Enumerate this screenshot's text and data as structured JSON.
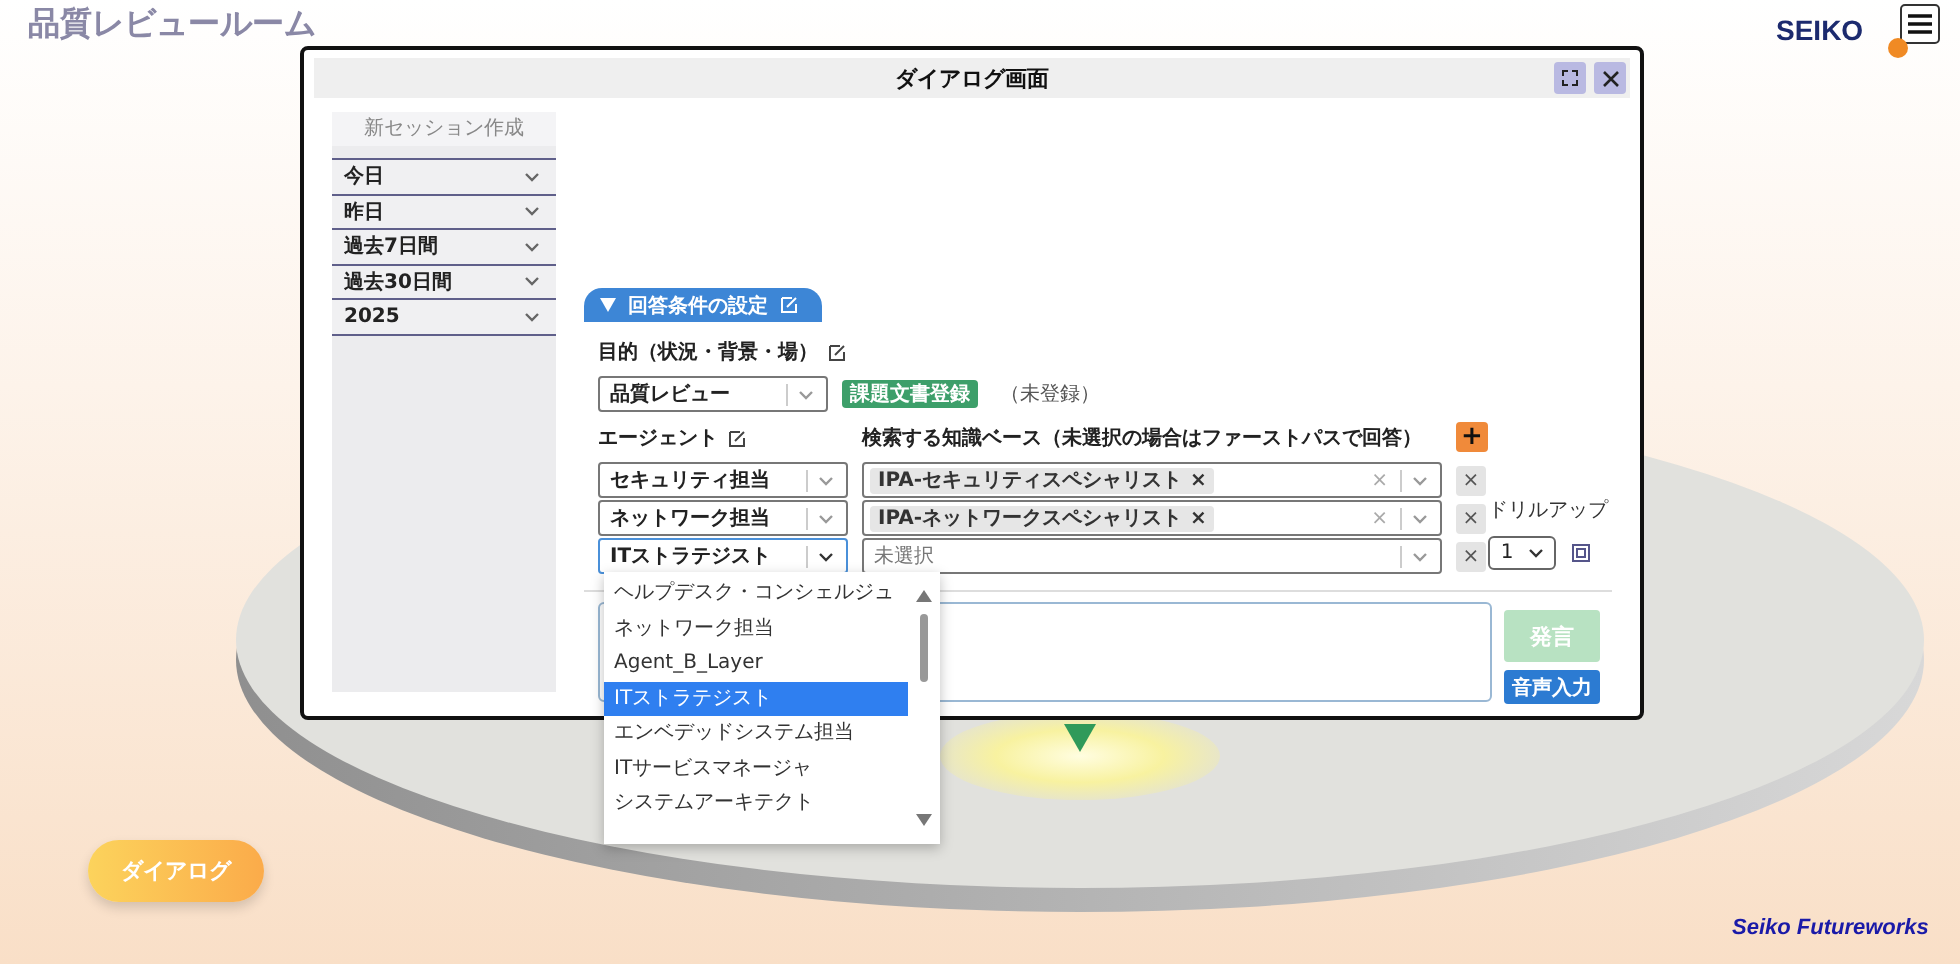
{
  "app_title": "品質レビュールーム",
  "brand": "SEIKO",
  "dialog": {
    "title": "ダイアログ画面",
    "sidebar": {
      "new_session": "新セッション作成",
      "groups": [
        "今日",
        "昨日",
        "過去7日間",
        "過去30日間",
        "2025"
      ]
    },
    "conditions_tab": "回答条件の設定",
    "purpose": {
      "label": "目的（状況・背景・場）",
      "value": "品質レビュー"
    },
    "register_button": "課題文書登録",
    "register_status": "（未登録）",
    "agent_label": "エージェント",
    "knowledge_label": "検索する知識ベース（未選択の場合はファーストパスで回答）",
    "add_button": "+",
    "agent_rows": [
      {
        "agent": "セキュリティ担当",
        "focused": false,
        "knowledge": [
          {
            "label": "IPA-セキュリティスペシャリスト",
            "remove": "×"
          }
        ],
        "clear": "×",
        "remove": "×"
      },
      {
        "agent": "ネットワーク担当",
        "focused": false,
        "knowledge": [
          {
            "label": "IPA-ネットワークスペシャリスト",
            "remove": "×"
          }
        ],
        "clear": "×",
        "remove": "×"
      },
      {
        "agent": "ITストラテジスト",
        "focused": true,
        "knowledge": [],
        "placeholder": "未選択",
        "remove": "×"
      }
    ],
    "agent_options": [
      {
        "label": "ヘルプデスク・コンシェルジュ",
        "selected": false
      },
      {
        "label": "ネットワーク担当",
        "selected": false
      },
      {
        "label": "Agent_B_Layer",
        "selected": false
      },
      {
        "label": "ITストラテジスト",
        "selected": true
      },
      {
        "label": "エンベデッドシステム担当",
        "selected": false
      },
      {
        "label": "ITサービスマネージャ",
        "selected": false
      },
      {
        "label": "システムアーキテクト",
        "selected": false
      }
    ],
    "drill_up": {
      "label": "ドリルアップ",
      "value": "1"
    },
    "send_button": {
      "label": "発言",
      "disabled": true
    },
    "voice_button": "音声入力"
  },
  "dialog_button": "ダイアログ",
  "footer_brand": "Seiko Futureworks"
}
